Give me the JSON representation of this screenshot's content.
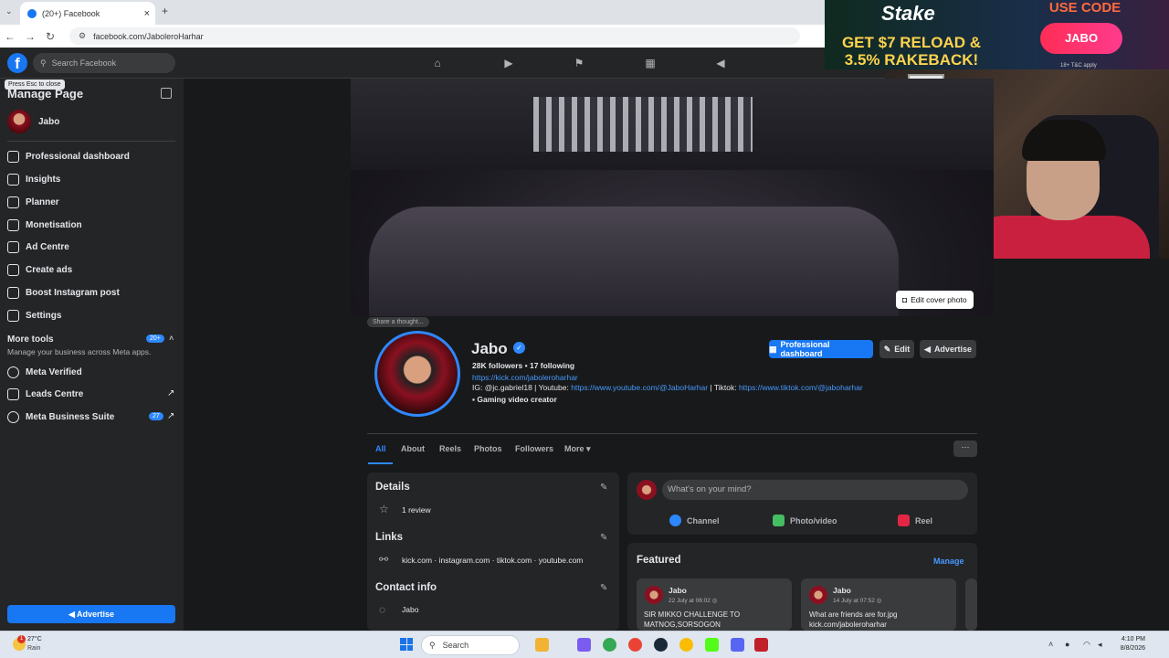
{
  "browser": {
    "tab_title": "(20+) Facebook",
    "url": "facebook.com/JaboleroHarhar",
    "new_tab": "+",
    "close_tab": "×"
  },
  "fb_header": {
    "search_placeholder": "Search Facebook",
    "logo": "f"
  },
  "ad": {
    "brand": "Stake",
    "line1": "GET $7 RELOAD &",
    "line2": "3.5% RAKEBACK!",
    "use_code": "USE CODE",
    "code": "JABO",
    "terms": "18+ T&C apply"
  },
  "sidebar": {
    "tooltip": "Press Esc to close",
    "title": "Manage Page",
    "page_name": "Jabo",
    "items": [
      {
        "label": "Professional dashboard"
      },
      {
        "label": "Insights"
      },
      {
        "label": "Planner"
      },
      {
        "label": "Monetisation"
      },
      {
        "label": "Ad Centre"
      },
      {
        "label": "Create ads"
      },
      {
        "label": "Boost Instagram post"
      },
      {
        "label": "Settings"
      }
    ],
    "more_tools": "More tools",
    "more_tools_badge": "20+",
    "more_tools_desc": "Manage your business across Meta apps.",
    "tools": [
      {
        "label": "Meta Verified"
      },
      {
        "label": "Leads Centre"
      },
      {
        "label": "Meta Business Suite",
        "badge": "27"
      }
    ],
    "advertise": "Advertise"
  },
  "profile": {
    "share_thought": "Share a thought...",
    "edit_cover": "Edit cover photo",
    "name": "Jabo",
    "followers": "28K followers • 17 following",
    "kick": "https://kick.com/jaboleroharhar",
    "bio_ig": "IG: @jc.gabriel18 | Youtube: ",
    "bio_yt": "https://www.youtube.com/@JaboHarhar",
    "bio_tt_label": " | Tiktok: ",
    "bio_tt": "https://www.tiktok.com/@jaboharhar",
    "category": "Gaming video creator",
    "btn_pro": "Professional dashboard",
    "btn_edit": "Edit",
    "btn_adv": "Advertise"
  },
  "tabs": [
    "All",
    "About",
    "Reels",
    "Photos",
    "Followers",
    "More ▾"
  ],
  "tabs_more_btn": "···",
  "details": {
    "title": "Details",
    "review": "1 review",
    "links_title": "Links",
    "links": "kick.com · instagram.com · tiktok.com · youtube.com",
    "contact_title": "Contact info",
    "contact": "Jabo"
  },
  "composer": {
    "placeholder": "What's on your mind?",
    "channel": "Channel",
    "photo": "Photo/video",
    "reel": "Reel"
  },
  "featured": {
    "title": "Featured",
    "manage": "Manage",
    "posts": [
      {
        "name": "Jabo",
        "date": "22 July at 06:02 ◎",
        "text1": "SIR MIKKO CHALLENGE TO",
        "text2": "MATNOG,SORSOGON"
      },
      {
        "name": "Jabo",
        "date": "14 July at 07:52 ◎",
        "text1": "What are friends are for.jpg",
        "text2": "kick.com/jaboleroharhar"
      }
    ]
  },
  "taskbar": {
    "temp": "27°C",
    "weather": "Rain",
    "weather_badge": "1",
    "search": "Search",
    "time": "4:10 PM",
    "date": "8/8/2026"
  }
}
